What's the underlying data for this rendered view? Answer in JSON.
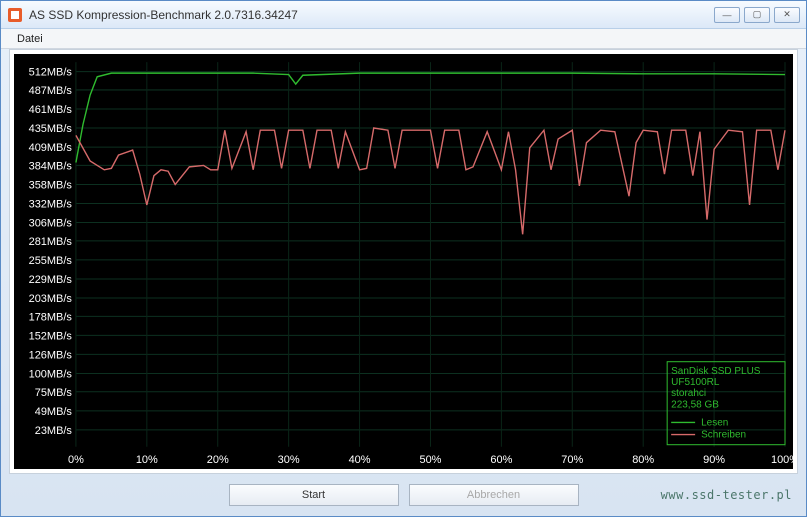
{
  "window": {
    "title": "AS SSD Kompression-Benchmark 2.0.7316.34247"
  },
  "menu": {
    "file": "Datei"
  },
  "buttons": {
    "start": "Start",
    "abort": "Abbrechen"
  },
  "winbtns": {
    "min": "—",
    "max": "▢",
    "close": "✕"
  },
  "legend": {
    "device": "SanDisk SSD PLUS",
    "firmware": "UF5100RL",
    "driver": "storahci",
    "capacity": "223,58 GB",
    "read": "Lesen",
    "write": "Schreiben"
  },
  "watermark": "www.ssd-tester.pl",
  "chart_data": {
    "type": "line",
    "xlabel": "",
    "ylabel": "",
    "x_unit": "%",
    "y_unit": "MB/s",
    "xlim": [
      0,
      100
    ],
    "ylim": [
      0,
      525
    ],
    "y_ticks": [
      23,
      49,
      75,
      100,
      126,
      152,
      178,
      203,
      229,
      255,
      281,
      306,
      332,
      358,
      384,
      409,
      435,
      461,
      487,
      512
    ],
    "y_tick_labels": [
      "23MB/s",
      "49MB/s",
      "75MB/s",
      "100MB/s",
      "126MB/s",
      "152MB/s",
      "178MB/s",
      "203MB/s",
      "229MB/s",
      "255MB/s",
      "281MB/s",
      "306MB/s",
      "332MB/s",
      "358MB/s",
      "384MB/s",
      "409MB/s",
      "435MB/s",
      "461MB/s",
      "487MB/s",
      "512MB/s"
    ],
    "x_ticks": [
      0,
      10,
      20,
      30,
      40,
      50,
      60,
      70,
      80,
      90,
      100
    ],
    "x_tick_labels": [
      "0%",
      "10%",
      "20%",
      "30%",
      "40%",
      "50%",
      "60%",
      "70%",
      "80%",
      "90%",
      "100%"
    ],
    "series": [
      {
        "name": "Lesen",
        "x": [
          0,
          1,
          2,
          3,
          5,
          8,
          15,
          25,
          30,
          31,
          32,
          40,
          50,
          60,
          70,
          80,
          90,
          100
        ],
        "values": [
          388,
          440,
          480,
          505,
          510,
          510,
          510,
          510,
          508,
          495,
          507,
          510,
          510,
          510,
          510,
          509,
          509,
          508
        ]
      },
      {
        "name": "Schreiben",
        "x": [
          0,
          2,
          4,
          5,
          6,
          8,
          9,
          10,
          11,
          12,
          13,
          14,
          16,
          18,
          19,
          20,
          21,
          22,
          24,
          25,
          26,
          28,
          29,
          30,
          32,
          33,
          34,
          36,
          37,
          38,
          40,
          41,
          42,
          44,
          45,
          46,
          48,
          50,
          51,
          52,
          54,
          55,
          56,
          58,
          60,
          61,
          62,
          63,
          64,
          66,
          67,
          68,
          70,
          71,
          72,
          74,
          76,
          78,
          79,
          80,
          82,
          83,
          84,
          86,
          87,
          88,
          89,
          90,
          92,
          94,
          95,
          96,
          98,
          99,
          100
        ],
        "values": [
          425,
          390,
          378,
          380,
          398,
          405,
          372,
          330,
          370,
          378,
          376,
          358,
          382,
          384,
          378,
          378,
          432,
          380,
          430,
          378,
          432,
          432,
          380,
          432,
          432,
          380,
          432,
          432,
          380,
          430,
          378,
          380,
          435,
          432,
          380,
          432,
          432,
          432,
          380,
          432,
          432,
          378,
          382,
          430,
          378,
          430,
          378,
          290,
          408,
          432,
          378,
          420,
          432,
          356,
          415,
          432,
          430,
          342,
          415,
          432,
          430,
          372,
          432,
          432,
          370,
          430,
          310,
          406,
          432,
          430,
          330,
          432,
          432,
          378,
          432
        ]
      }
    ]
  }
}
